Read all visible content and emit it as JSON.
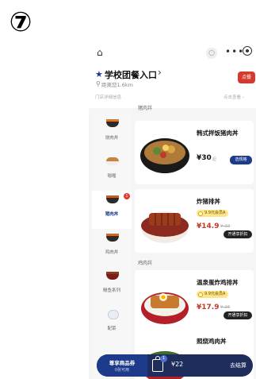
{
  "step": "⑦",
  "topbar": {
    "home_icon": "⌂",
    "search_icon": "○",
    "dots": "•••"
  },
  "store": {
    "name": "学校团餐入口",
    "chevron": "›",
    "distance": "距离您1.6km",
    "order_button": "点餐",
    "info_left": "门店详细信息",
    "info_right": "点击查看 ›"
  },
  "sidebar": {
    "items": [
      {
        "label": "烧肉丼"
      },
      {
        "label": "咖喱"
      },
      {
        "label": "猪肉丼",
        "badge": "1"
      },
      {
        "label": "鸡肉丼"
      },
      {
        "label": "鳗鱼系列"
      },
      {
        "label": "配菜"
      }
    ]
  },
  "sections": {
    "s1": "猪肉丼",
    "s2": "鸡肉丼"
  },
  "products": [
    {
      "name": "韩式拌饭猪肉丼",
      "price": "¥30",
      "unit": "起",
      "button": "选规格"
    },
    {
      "name": "炸猪排丼",
      "member": "9.9元会员A",
      "price": "¥14.9",
      "orig": "¥ 22",
      "button": "开通享折扣"
    },
    {
      "name": "温泉蛋炸鸡排丼",
      "member": "9.9元会员A",
      "price": "¥17.9",
      "orig": "¥ 26",
      "button": "开通享折扣"
    },
    {
      "name": "照烧鸡肉丼"
    }
  ],
  "bottom": {
    "coupon_title": "尊享商品券",
    "coupon_sub": "0张可用",
    "cart_count": "1",
    "total": "¥22",
    "checkout": "去结算"
  },
  "colors": {
    "brand": "#1e3a8a",
    "accent_red": "#d63a2f",
    "member_yellow": "#fde68a"
  }
}
